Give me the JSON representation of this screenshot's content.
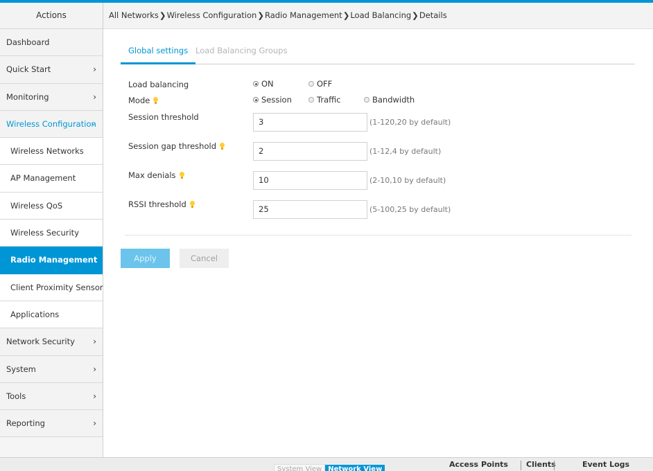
{
  "sidebar": {
    "header": "Actions",
    "items": [
      {
        "label": "Dashboard"
      },
      {
        "label": "Quick Start",
        "chevron": "›"
      },
      {
        "label": "Monitoring",
        "chevron": "›"
      },
      {
        "label": "Wireless Configuration",
        "chevron": "⌄"
      },
      {
        "label": "Wireless Networks"
      },
      {
        "label": "AP Management"
      },
      {
        "label": "Wireless QoS"
      },
      {
        "label": "Wireless Security"
      },
      {
        "label": "Radio Management"
      },
      {
        "label": "Client Proximity Sensor"
      },
      {
        "label": "Applications"
      },
      {
        "label": "Network Security",
        "chevron": "›"
      },
      {
        "label": "System",
        "chevron": "›"
      },
      {
        "label": "Tools",
        "chevron": "›"
      },
      {
        "label": "Reporting",
        "chevron": "›"
      }
    ]
  },
  "breadcrumb": {
    "items": [
      "All Networks",
      "Wireless Configuration",
      "Radio Management",
      "Load Balancing",
      "Details"
    ],
    "separator": "❯"
  },
  "tabs": {
    "global": "Global settings",
    "groups": "Load Balancing Groups"
  },
  "form": {
    "load_balancing": {
      "label": "Load balancing",
      "on": "ON",
      "off": "OFF",
      "selected": "ON"
    },
    "mode": {
      "label": "Mode",
      "session": "Session",
      "traffic": "Traffic",
      "bandwidth": "Bandwidth",
      "selected": "Session"
    },
    "session_threshold": {
      "label": "Session threshold",
      "value": "3",
      "hint": "(1-120,20 by default)"
    },
    "session_gap": {
      "label": "Session gap threshold",
      "value": "2",
      "hint": "(1-12,4 by default)"
    },
    "max_denials": {
      "label": "Max denials",
      "value": "10",
      "hint": "(2-10,10 by default)"
    },
    "rssi": {
      "label": "RSSI threshold",
      "value": "25",
      "hint": "(5-100,25 by default)"
    }
  },
  "buttons": {
    "apply": "Apply",
    "cancel": "Cancel"
  },
  "footer": {
    "system_view": "System View",
    "network_view": "Network View",
    "access_points": "Access Points",
    "clients": "Clients",
    "event_logs": "Event Logs"
  },
  "colors": {
    "accent": "#0096d6",
    "hint_icon": "#ffcc33"
  },
  "icons": {
    "info": "lightbulb-icon",
    "expand": "chevron-right-icon",
    "collapse": "chevron-down-icon"
  }
}
